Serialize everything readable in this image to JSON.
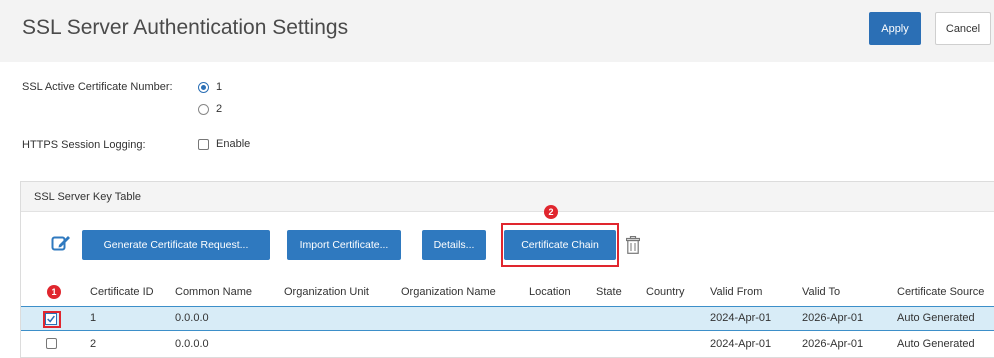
{
  "header": {
    "title": "SSL Server Authentication Settings",
    "apply_label": "Apply",
    "cancel_label": "Cancel"
  },
  "form": {
    "active_cert_label": "SSL Active Certificate Number:",
    "active_cert_options": [
      "1",
      "2"
    ],
    "active_cert_selected": "1",
    "https_logging_label": "HTTPS Session Logging:",
    "https_logging_option": "Enable",
    "https_logging_checked": false
  },
  "table_panel": {
    "title": "SSL Server Key Table",
    "buttons": {
      "generate": "Generate Certificate Request...",
      "import": "Import Certificate...",
      "details": "Details...",
      "chain": "Certificate Chain"
    },
    "annotations": [
      "1",
      "2"
    ],
    "columns": [
      "Certificate ID",
      "Common Name",
      "Organization Unit",
      "Organization Name",
      "Location",
      "State",
      "Country",
      "Valid From",
      "Valid To",
      "Certificate Source"
    ],
    "rows": [
      {
        "selected": true,
        "cells": [
          "1",
          "0.0.0.0",
          "",
          "",
          "",
          "",
          "",
          "2024-Apr-01",
          "2026-Apr-01",
          "Auto Generated"
        ]
      },
      {
        "selected": false,
        "cells": [
          "2",
          "0.0.0.0",
          "",
          "",
          "",
          "",
          "",
          "2024-Apr-01",
          "2026-Apr-01",
          "Auto Generated"
        ]
      }
    ]
  },
  "colors": {
    "primary_button": "#2f79bf",
    "annotation_red": "#e0262e",
    "selected_row": "#d8ecf7"
  }
}
